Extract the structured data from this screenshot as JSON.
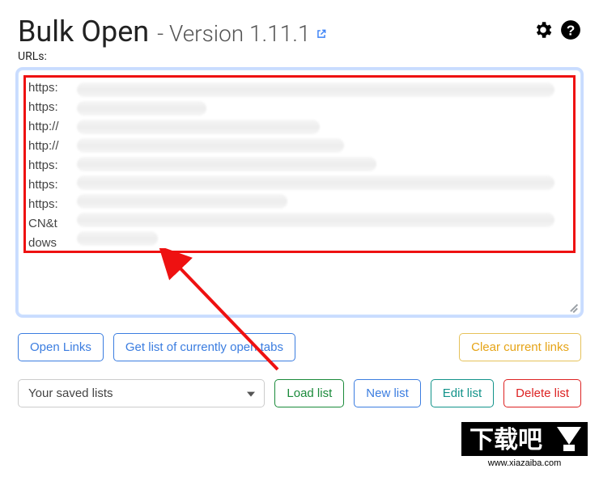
{
  "header": {
    "title": "Bulk Open",
    "version_prefix": "- Version",
    "version": "1.11.1"
  },
  "urls_label": "URLs:",
  "textarea_value": "https:\nhttps:\nhttp://\nhttp://\nhttps:\nhttps:\nhttps:\nCN&t\ndows",
  "buttons": {
    "open_links": "Open Links",
    "get_tabs": "Get list of currently open tabs",
    "clear": "Clear current links",
    "load": "Load list",
    "new": "New list",
    "edit": "Edit list",
    "delete": "Delete list"
  },
  "select": {
    "placeholder": "Your saved lists"
  },
  "watermark": {
    "text_main": "下载吧",
    "text_url": "www.xiazaiba.com"
  }
}
